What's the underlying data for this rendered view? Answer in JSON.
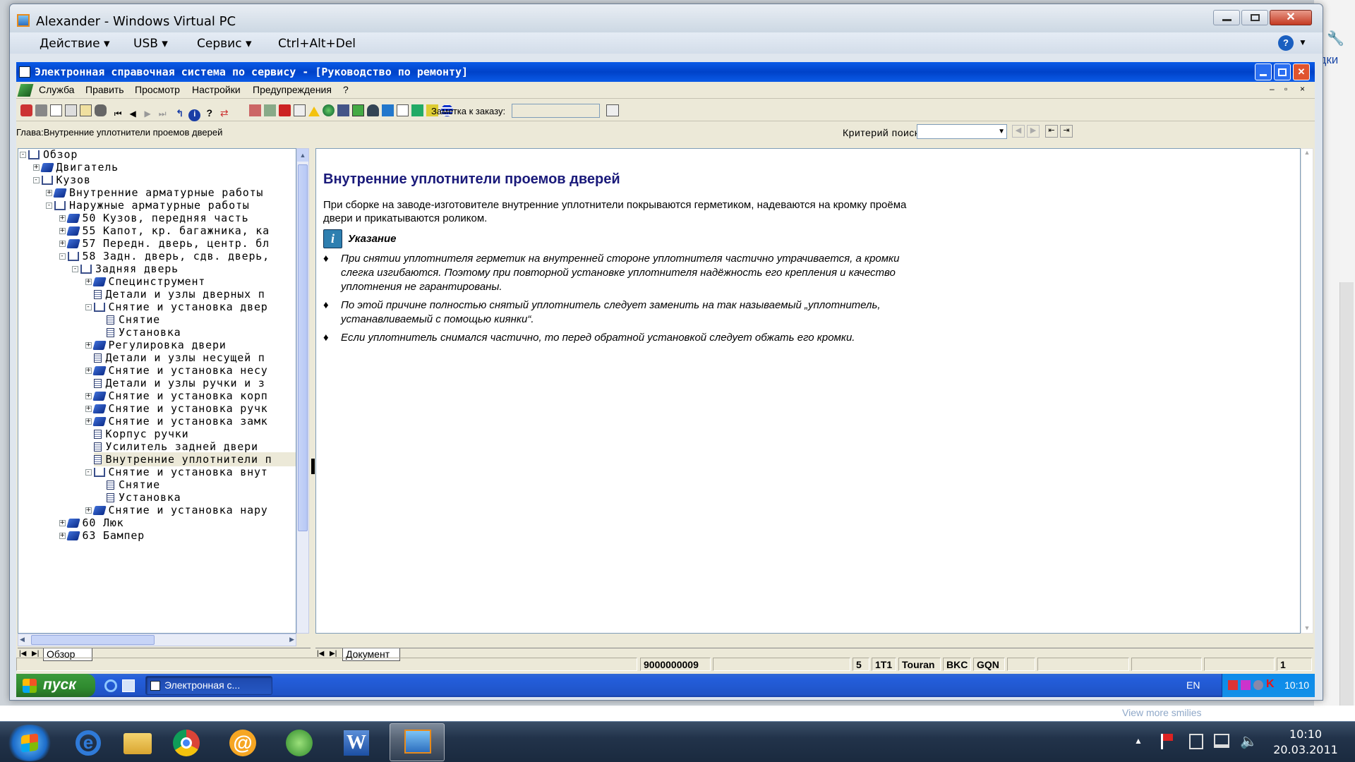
{
  "vpc": {
    "title": "Alexander - Windows Virtual PC",
    "menu": [
      "Действие",
      "USB",
      "Сервис",
      "Ctrl+Alt+Del"
    ],
    "help": "?"
  },
  "app": {
    "title": "Электронная справочная система по сервису - [Руководство по ремонту]",
    "menu": [
      "Служба",
      "Править",
      "Просмотр",
      "Настройки",
      "Предупреждения",
      "?"
    ],
    "note_label": "Заметка к заказу:",
    "chapter": "Глава:Внутренние уплотнители проемов дверей",
    "search_label": "Критерий поиска:"
  },
  "tree": [
    {
      "label": "Обзор",
      "level": 0,
      "icon": "open",
      "exp": "-"
    },
    {
      "label": "Двигатель",
      "level": 1,
      "icon": "closed",
      "exp": "+"
    },
    {
      "label": "Кузов",
      "level": 1,
      "icon": "open",
      "exp": "-"
    },
    {
      "label": "Внутренние арматурные работы",
      "level": 2,
      "icon": "closed",
      "exp": "+"
    },
    {
      "label": "Наружные арматурные работы",
      "level": 2,
      "icon": "open",
      "exp": "-"
    },
    {
      "label": "50 Кузов, передняя часть",
      "level": 3,
      "icon": "closed",
      "exp": "+"
    },
    {
      "label": "55 Капот, кр. багажника, ка",
      "level": 3,
      "icon": "closed",
      "exp": "+"
    },
    {
      "label": "57 Передн. дверь, центр. бл",
      "level": 3,
      "icon": "closed",
      "exp": "+"
    },
    {
      "label": "58 Задн. дверь, сдв. дверь,",
      "level": 3,
      "icon": "open",
      "exp": "-"
    },
    {
      "label": "Задняя дверь",
      "level": 4,
      "icon": "open",
      "exp": "-"
    },
    {
      "label": "Специнструмент",
      "level": 5,
      "icon": "closed",
      "exp": "+"
    },
    {
      "label": "Детали и узлы дверных п",
      "level": 5,
      "icon": "page",
      "exp": ""
    },
    {
      "label": "Снятие и установка двер",
      "level": 5,
      "icon": "open",
      "exp": "-"
    },
    {
      "label": "Снятие",
      "level": 6,
      "icon": "page",
      "exp": ""
    },
    {
      "label": "Установка",
      "level": 6,
      "icon": "page",
      "exp": ""
    },
    {
      "label": "Регулировка двери",
      "level": 5,
      "icon": "closed",
      "exp": "+"
    },
    {
      "label": "Детали и узлы несущей п",
      "level": 5,
      "icon": "page",
      "exp": ""
    },
    {
      "label": "Снятие и установка несу",
      "level": 5,
      "icon": "closed",
      "exp": "+"
    },
    {
      "label": "Детали и узлы ручки и з",
      "level": 5,
      "icon": "page",
      "exp": ""
    },
    {
      "label": "Снятие и установка корп",
      "level": 5,
      "icon": "closed",
      "exp": "+"
    },
    {
      "label": "Снятие и установка ручк",
      "level": 5,
      "icon": "closed",
      "exp": "+"
    },
    {
      "label": "Снятие и установка замк",
      "level": 5,
      "icon": "closed",
      "exp": "+"
    },
    {
      "label": "Корпус ручки",
      "level": 5,
      "icon": "page",
      "exp": ""
    },
    {
      "label": "Усилитель задней двери",
      "level": 5,
      "icon": "page",
      "exp": ""
    },
    {
      "label": "Внутренние уплотнители п",
      "level": 5,
      "icon": "page",
      "exp": "",
      "selected": true
    },
    {
      "label": "Снятие и установка внут",
      "level": 5,
      "icon": "open",
      "exp": "-"
    },
    {
      "label": "Снятие",
      "level": 6,
      "icon": "page",
      "exp": ""
    },
    {
      "label": "Установка",
      "level": 6,
      "icon": "page",
      "exp": ""
    },
    {
      "label": "Снятие и установка нару",
      "level": 5,
      "icon": "closed",
      "exp": "+"
    },
    {
      "label": "60 Люк",
      "level": 3,
      "icon": "closed",
      "exp": "+"
    },
    {
      "label": "63 Бампер",
      "level": 3,
      "icon": "closed",
      "exp": "+"
    }
  ],
  "tabs": {
    "left": "Обзор",
    "right": "Документ"
  },
  "doc": {
    "heading": "Внутренние уплотнители проемов дверей",
    "intro": "При сборке на заводе-изготовителе внутренние уплотнители покрываются герметиком, надеваются на кромку проёма двери и прикатываются роликом.",
    "note_title": "Указание",
    "bullets": [
      "При снятии уплотнителя герметик на внутренней стороне уплотнителя частично утрачивается, а кромки слегка изгибаются. Поэтому при повторной установке уплотнителя надёжность его крепления и качество уплотнения не гарантированы.",
      "По этой причине полностью снятый уплотнитель следует заменить на так называемый „уплотнитель, устанавливаемый с помощью киянки“.",
      "Если уплотнитель снимался частично, то перед обратной установкой следует обжать его кромки."
    ]
  },
  "status": {
    "order": "9000000009",
    "c1": "5",
    "c2": "1T1",
    "model": "Touran",
    "c3": "BKC",
    "c4": "GQN",
    "page": "1"
  },
  "xptaskbar": {
    "start": "пуск",
    "task": "Электронная с...",
    "lang": "EN",
    "time": "10:10"
  },
  "win7": {
    "time": "10:10",
    "date": "20.03.2011"
  },
  "bg": {
    "text1": "здки",
    "text2": "View more smilies"
  }
}
